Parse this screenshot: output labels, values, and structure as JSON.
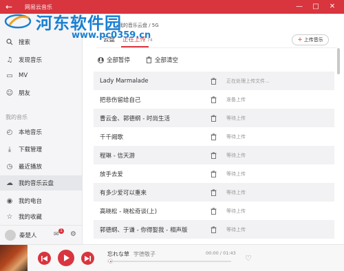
{
  "titlebar": {
    "title": "网易云音乐",
    "back_glyph": "←",
    "minimize_glyph": "—",
    "maximize_glyph": "□",
    "close_glyph": "✕"
  },
  "watermark": {
    "text": "河东软件园",
    "url": "www.pc0359.cn"
  },
  "sidebar": {
    "search_label": "搜索",
    "items": [
      {
        "label": "发现音乐",
        "icon": "music-note-icon",
        "glyph": "♫"
      },
      {
        "label": "MV",
        "icon": "video-icon",
        "glyph": "▭"
      },
      {
        "label": "朋友",
        "icon": "friends-icon",
        "glyph": "☺"
      }
    ],
    "section_title": "我的音乐",
    "my_music": [
      {
        "label": "本地音乐",
        "icon": "local-music-icon",
        "glyph": "◴"
      },
      {
        "label": "下载管理",
        "icon": "download-icon",
        "glyph": "⤓"
      },
      {
        "label": "最近播放",
        "icon": "recent-icon",
        "glyph": "◷"
      },
      {
        "label": "我的音乐云盘",
        "icon": "cloud-icon",
        "glyph": "☁",
        "active": true
      },
      {
        "label": "我的电台",
        "icon": "radio-icon",
        "glyph": "◉"
      },
      {
        "label": "我的收藏",
        "icon": "collection-icon",
        "glyph": "☆"
      }
    ],
    "user": {
      "name": "秦楚人",
      "mail_badge": "1"
    }
  },
  "main": {
    "breadcrumb": "我的音乐云盘 / 5G",
    "tabs": [
      {
        "label": "云盘",
        "active": false
      },
      {
        "label": "正在上传",
        "count": "74",
        "active": true
      }
    ],
    "upload_button": "上传音乐",
    "actions": {
      "pause_all": "全部暂停",
      "clear_all": "全部清空"
    },
    "rows": [
      {
        "name": "Lady Marmalade",
        "status": "正在处理上传文件..."
      },
      {
        "name": "把悲伤留给自己",
        "status": "准备上传"
      },
      {
        "name": "曹云金、郭德纲 - 时尚生活",
        "status": "等待上传"
      },
      {
        "name": "千千阙歌",
        "status": "等待上传"
      },
      {
        "name": "程琳 - 信天游",
        "status": "等待上传"
      },
      {
        "name": "放手去爱",
        "status": "等待上传"
      },
      {
        "name": "有多少爱可以重来",
        "status": "等待上传"
      },
      {
        "name": "高晓松 - 晓松奇谈(上)",
        "status": "等待上传"
      },
      {
        "name": "郭德纲、于谦 - 你得娶我 - 相声版",
        "status": "等待上传"
      }
    ]
  },
  "player": {
    "song": "忘れな草",
    "artist": "宇德敬子",
    "time_current": "00:00",
    "time_total": "01:43",
    "progress": 0.0,
    "accent": "#d8353f"
  }
}
